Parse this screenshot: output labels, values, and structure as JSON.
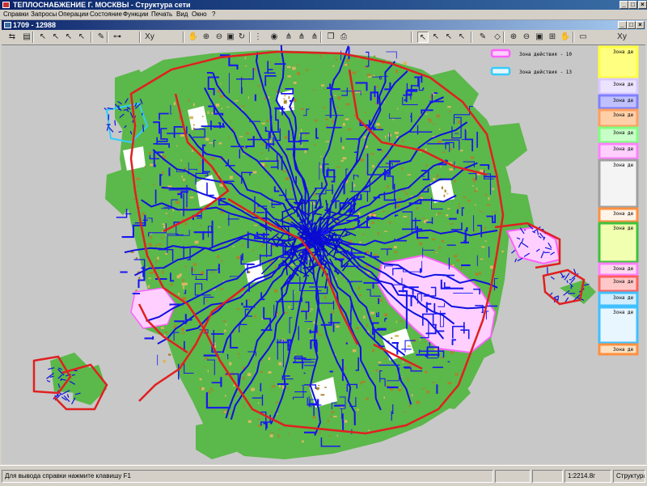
{
  "window": {
    "title": "ТЕПЛОСНАБЖЕНИЕ Г. МОСКВЫ - Структура сети",
    "buttons": {
      "minimize": "_",
      "maximize": "□",
      "close": "×"
    }
  },
  "menu": {
    "items": [
      "Справки",
      "Запросы",
      "Операции",
      "Состояние",
      "Функции",
      "Печать",
      "Вид",
      "Окно",
      "?"
    ]
  },
  "child_window": {
    "title": "1709 - 12988"
  },
  "toolbar": {
    "buttons": [
      {
        "icon": "navigate-icon",
        "glyph": "⇆"
      },
      {
        "icon": "save-icon",
        "glyph": "▤"
      },
      {
        "icon": "select-arrow-icon",
        "glyph": "↖"
      },
      {
        "icon": "select-point-icon",
        "glyph": "↖"
      },
      {
        "icon": "select-line-icon",
        "glyph": "↖"
      },
      {
        "icon": "select-area-icon",
        "glyph": "↖"
      },
      {
        "icon": "edit-pencil-icon",
        "glyph": "✎"
      },
      {
        "icon": "binoculars-icon",
        "glyph": "⊶"
      },
      {
        "icon": "xy-coordinates-icon",
        "glyph": "Xy"
      },
      {
        "icon": "pan-hand-icon",
        "glyph": "✋"
      },
      {
        "icon": "zoom-in-icon",
        "glyph": "⊕"
      },
      {
        "icon": "zoom-out-icon",
        "glyph": "⊖"
      },
      {
        "icon": "zoom-window-icon",
        "glyph": "▣"
      },
      {
        "icon": "refresh-icon",
        "glyph": "↻"
      },
      {
        "icon": "traffic-light-icon",
        "glyph": "⋮"
      },
      {
        "icon": "target-icon",
        "glyph": "◉"
      },
      {
        "icon": "network-tree-icon",
        "glyph": "⋔"
      },
      {
        "icon": "network-branch-icon",
        "glyph": "⋔"
      },
      {
        "icon": "network-link-icon",
        "glyph": "⋔"
      },
      {
        "icon": "copy-icon",
        "glyph": "❐"
      },
      {
        "icon": "print-icon",
        "glyph": "⎙"
      }
    ],
    "right_buttons": [
      {
        "icon": "select-arrow-icon",
        "glyph": "↖"
      },
      {
        "icon": "select-point-icon",
        "glyph": "↖"
      },
      {
        "icon": "select-line-icon",
        "glyph": "↖"
      },
      {
        "icon": "select-area-icon",
        "glyph": "↖"
      },
      {
        "icon": "edit-pencil-icon",
        "glyph": "✎"
      },
      {
        "icon": "eraser-icon",
        "glyph": "◇"
      },
      {
        "icon": "zoom-in-icon",
        "glyph": "⊕"
      },
      {
        "icon": "zoom-out-icon",
        "glyph": "⊖"
      },
      {
        "icon": "zoom-window-icon",
        "glyph": "▣"
      },
      {
        "icon": "zoom-extent-icon",
        "glyph": "⊞"
      },
      {
        "icon": "pan-hand-icon",
        "glyph": "✋"
      },
      {
        "icon": "rectangle-icon",
        "glyph": "▭"
      },
      {
        "icon": "xy-coordinates-icon",
        "glyph": "Xy"
      }
    ]
  },
  "map": {
    "legend": [
      {
        "label": "Зона действия - 10",
        "color": "#ff80ff"
      },
      {
        "label": "Зона действия - 13",
        "color": "#33ccff"
      }
    ],
    "zone_panel": [
      {
        "label": "Зона де",
        "color": "#ffff40",
        "fill": "#ffff80"
      },
      {
        "label": "Зона де",
        "color": "#d8c8ff",
        "fill": "#ece4ff"
      },
      {
        "label": "Зона де",
        "color": "#8080ff",
        "fill": "#c0c0ff"
      },
      {
        "label": "Зона де",
        "color": "#ffa060",
        "fill": "#ffd0a8"
      },
      {
        "label": "Зона де",
        "color": "#80ff80",
        "fill": "#c8ffc8"
      },
      {
        "label": "Зона де",
        "color": "#ff80ff",
        "fill": "#ffd0ff"
      },
      {
        "label": "Зона де",
        "color": "#a0a0a0",
        "fill": "#f4f4f4"
      },
      {
        "label": "Зона де",
        "color": "#ff9040",
        "fill": "#fff4e8"
      },
      {
        "label": "Зона де",
        "color": "#40c040",
        "fill": "#f0ffb0"
      },
      {
        "label": "Зона де",
        "color": "#ff80ff",
        "fill": "#ffd8f0"
      },
      {
        "label": "Зона де",
        "color": "#ff6060",
        "fill": "#ffc8c8"
      },
      {
        "label": "Зона де",
        "color": "#40c0ff",
        "fill": "#d0eeff"
      },
      {
        "label": "Зона де",
        "color": "#40c0ff",
        "fill": "#e8f6ff"
      },
      {
        "label": "Зона де",
        "color": "#ff9040",
        "fill": "#ffe0c0"
      }
    ],
    "colors": {
      "background": "#c8c8c8",
      "green_zones": "#5bb84a",
      "ring_roads": "#e02020",
      "heat_network": "#1010e0",
      "buildings": "#b08a30",
      "district_10": "#ff80ff",
      "district_13": "#33ccff"
    }
  },
  "status": {
    "help": "Для вывода справки нажмите клавишу F1",
    "scale": "1:2214.8г",
    "mode": "Структура сети"
  }
}
